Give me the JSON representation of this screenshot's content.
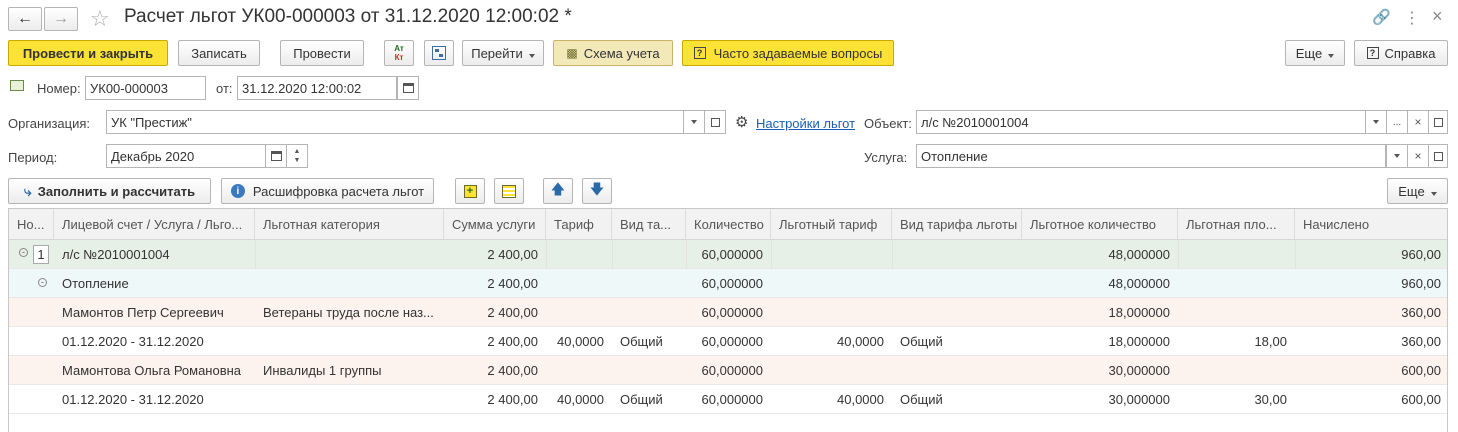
{
  "window": {
    "title": "Расчет льгот УК00-000003 от 31.12.2020 12:00:02 *"
  },
  "toolbar": {
    "post_close": "Провести и закрыть",
    "save": "Записать",
    "post": "Провести",
    "dtkt_top": "Ат",
    "dtkt_bottom": "Кт",
    "goto": "Перейти",
    "schema": "Схема учета",
    "faq": "Часто задаваемые вопросы",
    "more": "Еще",
    "help": "Справка"
  },
  "header": {
    "number_label": "Номер:",
    "number_value": "УК00-000003",
    "date_label": "от:",
    "date_value": "31.12.2020 12:00:02"
  },
  "form": {
    "org_label": "Организация:",
    "org_value": "УК \"Престиж\"",
    "settings_link": "Настройки льгот",
    "object_label": "Объект:",
    "object_value": "л/с №2010001004",
    "period_label": "Период:",
    "period_value": "Декабрь 2020",
    "service_label": "Услуга:",
    "service_value": "Отопление"
  },
  "table_toolbar": {
    "fill": "Заполнить и рассчитать",
    "decode": "Расшифровка расчета льгот",
    "more": "Еще"
  },
  "table": {
    "columns": [
      "Но...",
      "Лицевой счет / Услуга / Льго...",
      "Льготная категория",
      "Сумма услуги",
      "Тариф",
      "Вид та...",
      "Количество",
      "Льготный тариф",
      "Вид тарифа льготы",
      "Льготное количество",
      "Льготная пло...",
      "Начислено"
    ],
    "rows": [
      {
        "no": "1",
        "name": "л/с №2010001004",
        "category": "",
        "sum": "2 400,00",
        "tariff": "",
        "tariff_type": "",
        "qty": "60,000000",
        "ben_tariff": "",
        "ben_tariff_type": "",
        "ben_qty": "48,000000",
        "ben_area": "",
        "accrued": "960,00"
      },
      {
        "no": "",
        "name": "Отопление",
        "category": "",
        "sum": "2 400,00",
        "tariff": "",
        "tariff_type": "",
        "qty": "60,000000",
        "ben_tariff": "",
        "ben_tariff_type": "",
        "ben_qty": "48,000000",
        "ben_area": "",
        "accrued": "960,00"
      },
      {
        "no": "",
        "name": "Мамонтов Петр Сергеевич",
        "category": "Ветераны труда после наз...",
        "sum": "2 400,00",
        "tariff": "",
        "tariff_type": "",
        "qty": "60,000000",
        "ben_tariff": "",
        "ben_tariff_type": "",
        "ben_qty": "18,000000",
        "ben_area": "",
        "accrued": "360,00"
      },
      {
        "no": "",
        "name": "01.12.2020 - 31.12.2020",
        "category": "",
        "sum": "2 400,00",
        "tariff": "40,0000",
        "tariff_type": "Общий",
        "qty": "60,000000",
        "ben_tariff": "40,0000",
        "ben_tariff_type": "Общий",
        "ben_qty": "18,000000",
        "ben_area": "18,00",
        "accrued": "360,00"
      },
      {
        "no": "",
        "name": "Мамонтова Ольга Романовна",
        "category": "Инвалиды 1 группы",
        "sum": "2 400,00",
        "tariff": "",
        "tariff_type": "",
        "qty": "60,000000",
        "ben_tariff": "",
        "ben_tariff_type": "",
        "ben_qty": "30,000000",
        "ben_area": "",
        "accrued": "600,00"
      },
      {
        "no": "",
        "name": "01.12.2020 - 31.12.2020",
        "category": "",
        "sum": "2 400,00",
        "tariff": "40,0000",
        "tariff_type": "Общий",
        "qty": "60,000000",
        "ben_tariff": "40,0000",
        "ben_tariff_type": "Общий",
        "ben_qty": "30,000000",
        "ben_area": "30,00",
        "accrued": "600,00"
      }
    ]
  },
  "colors": {
    "primary_button": "#fbe234",
    "row_group1": "#e6f0e6",
    "row_group2": "#eef8f8",
    "row_person": "#fdf3ee",
    "link": "#1a5fb4"
  }
}
